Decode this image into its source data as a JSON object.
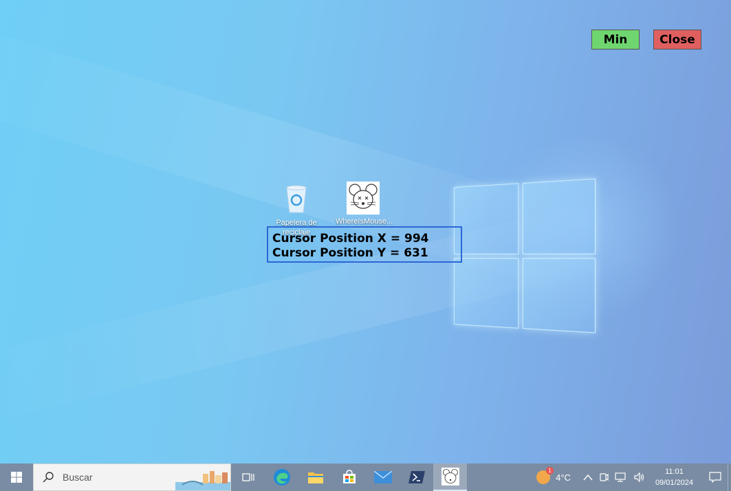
{
  "desktop": {
    "icons": [
      {
        "label": "Papelera de reciclaje"
      },
      {
        "label": "WhereIsMouse..."
      }
    ]
  },
  "overlay": {
    "line_x": "Cursor Position X = 994",
    "line_y": "Cursor Position Y = 631"
  },
  "buttons": {
    "min_label": "Min",
    "close_label": "Close"
  },
  "taskbar": {
    "search_placeholder": "Buscar",
    "apps": [
      "task-view-icon",
      "edge-icon",
      "file-explorer-icon",
      "store-icon",
      "mail-icon",
      "powershell-icon",
      "whereismouse-icon"
    ],
    "weather": {
      "temp": "4°C",
      "badge": "1"
    },
    "time": "11:01",
    "date": "09/01/2024"
  },
  "colors": {
    "overlay_border": "#2c66d6",
    "min_button": "#6fd66f",
    "close_button": "#e06060",
    "taskbar": "#7a8ca3"
  }
}
